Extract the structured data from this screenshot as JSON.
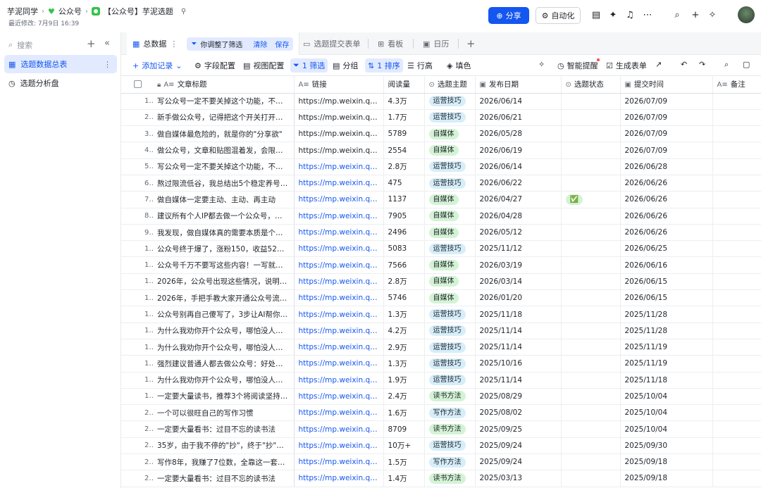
{
  "breadcrumb": {
    "root": "芋泥同学",
    "folder": "公众号",
    "doc": "【公众号】芋泥选题"
  },
  "modified": "最近修改: 7月9日 16:39",
  "header": {
    "share": "分享",
    "automation": "自动化"
  },
  "sidebar": {
    "search_placeholder": "搜索",
    "items": [
      {
        "label": "选题数据总表",
        "active": true
      },
      {
        "label": "选题分析盘",
        "active": false
      }
    ]
  },
  "tabs": {
    "main": "总数据",
    "filter_chip": "你调整了筛选",
    "clear": "清除",
    "save": "保存",
    "form": "选题提交表单",
    "kanban": "看板",
    "calendar": "日历"
  },
  "toolbar": {
    "add": "添加记录",
    "fields": "字段配置",
    "view": "视图配置",
    "filter": "1 筛选",
    "group": "分组",
    "sort": "1 排序",
    "rowheight": "行高",
    "fill": "填色",
    "remind": "智能提醒",
    "form": "生成表单"
  },
  "columns": [
    "文章标题",
    "链接",
    "阅读量",
    "选题主题",
    "发布日期",
    "选题状态",
    "提交时间",
    "备注"
  ],
  "rows": [
    {
      "n": "1",
      "title": "写公众号一定不要关掉这个功能，不然...",
      "link": "https://mp.weixin.qq.co...",
      "blue": false,
      "reads": "4.3万",
      "topic": "运营技巧",
      "pub": "2026/06/14",
      "status": "",
      "submit": "2026/07/09"
    },
    {
      "n": "2",
      "title": "新手做公众号，记得把这个开关打开，...",
      "link": "https://mp.weixin.qq.co...",
      "blue": false,
      "reads": "1.7万",
      "topic": "运营技巧",
      "pub": "2026/06/21",
      "status": "",
      "submit": "2026/07/09"
    },
    {
      "n": "3",
      "title": "做自媒体最危险的，就是你的\"分享欲\"",
      "link": "https://mp.weixin.qq.co...",
      "blue": false,
      "reads": "5789",
      "topic": "自媒体",
      "pub": "2026/05/28",
      "status": "",
      "submit": "2026/07/09"
    },
    {
      "n": "4",
      "title": "做公众号，文章和贴图混着发，会限流...",
      "link": "https://mp.weixin.qq.co...",
      "blue": false,
      "reads": "2554",
      "topic": "自媒体",
      "pub": "2026/06/19",
      "status": "",
      "submit": "2026/07/09"
    },
    {
      "n": "5",
      "title": "写公众号一定不要关掉这个功能，不然...",
      "link": "https://mp.weixin.qq.co...",
      "blue": true,
      "reads": "2.8万",
      "topic": "运营技巧",
      "pub": "2026/06/14",
      "status": "",
      "submit": "2026/06/28"
    },
    {
      "n": "6",
      "title": "熬过限流低谷，我总结出5个稳定养号小...",
      "link": "https://mp.weixin.qq.co...",
      "blue": true,
      "reads": "475",
      "topic": "运营技巧",
      "pub": "2026/06/22",
      "status": "",
      "submit": "2026/06/26"
    },
    {
      "n": "7",
      "title": "做自媒体一定要主动、主动、再主动",
      "link": "https://mp.weixin.qq.co...",
      "blue": true,
      "reads": "1137",
      "topic": "自媒体",
      "pub": "2026/04/27",
      "status": "✅",
      "submit": "2026/06/26"
    },
    {
      "n": "8",
      "title": "建议所有个人IP都去做一个公众号，因为...",
      "link": "https://mp.weixin.qq.co...",
      "blue": true,
      "reads": "7905",
      "topic": "自媒体",
      "pub": "2026/04/28",
      "status": "",
      "submit": "2026/06/26"
    },
    {
      "n": "9",
      "title": "我发现，做自媒体真的需要本质是个厉...",
      "link": "https://mp.weixin.qq.co...",
      "blue": true,
      "reads": "2496",
      "topic": "自媒体",
      "pub": "2026/05/12",
      "status": "",
      "submit": "2026/06/26"
    },
    {
      "n": "10",
      "title": "公众号终于爆了，涨粉150，收益52，送...",
      "link": "https://mp.weixin.qq.co...",
      "blue": true,
      "reads": "5083",
      "topic": "运营技巧",
      "pub": "2025/11/12",
      "status": "",
      "submit": "2026/06/25"
    },
    {
      "n": "11",
      "title": "公众号千万不要写这些内容！一写就限流",
      "link": "https://mp.weixin.qq.co...",
      "blue": true,
      "reads": "7566",
      "topic": "自媒体",
      "pub": "2026/03/19",
      "status": "",
      "submit": "2026/06/16"
    },
    {
      "n": "12",
      "title": "2026年，公众号出现这些情况，说明你...",
      "link": "https://mp.weixin.qq.co...",
      "blue": true,
      "reads": "2.8万",
      "topic": "自媒体",
      "pub": "2026/03/14",
      "status": "",
      "submit": "2026/06/15"
    },
    {
      "n": "13",
      "title": "2026年，手把手教大家开通公众号流量...",
      "link": "https://mp.weixin.qq.co...",
      "blue": true,
      "reads": "5746",
      "topic": "自媒体",
      "pub": "2026/01/20",
      "status": "",
      "submit": "2026/06/15"
    },
    {
      "n": "14",
      "title": "公众号别再自己傻写了，3步让AI帮你复...",
      "link": "https://mp.weixin.qq.co...",
      "blue": true,
      "reads": "1.3万",
      "topic": "运营技巧",
      "pub": "2025/11/18",
      "status": "",
      "submit": "2025/11/28"
    },
    {
      "n": "15",
      "title": "为什么我劝你开个公众号，哪怕没人看...",
      "link": "https://mp.weixin.qq.co...",
      "blue": true,
      "reads": "4.2万",
      "topic": "运营技巧",
      "pub": "2025/11/14",
      "status": "",
      "submit": "2025/11/28"
    },
    {
      "n": "16",
      "title": "为什么我劝你开个公众号，哪怕没人看...",
      "link": "https://mp.weixin.qq.co...",
      "blue": true,
      "reads": "2.9万",
      "topic": "运营技巧",
      "pub": "2025/11/14",
      "status": "",
      "submit": "2025/11/19"
    },
    {
      "n": "17",
      "title": "强烈建议普通人都去做公众号：好处太多",
      "link": "https://mp.weixin.qq.co...",
      "blue": true,
      "reads": "1.3万",
      "topic": "运营技巧",
      "pub": "2025/10/16",
      "status": "",
      "submit": "2025/11/19"
    },
    {
      "n": "18",
      "title": "为什么我劝你开个公众号，哪怕没人看...",
      "link": "https://mp.weixin.qq.co...",
      "blue": true,
      "reads": "1.9万",
      "topic": "运营技巧",
      "pub": "2025/11/14",
      "status": "",
      "submit": "2025/11/18"
    },
    {
      "n": "19",
      "title": "一定要大量读书，推荐3个将阅读坚持下...",
      "link": "https://mp.weixin.qq.co...",
      "blue": true,
      "reads": "2.4万",
      "topic": "读书方法",
      "pub": "2025/08/29",
      "status": "",
      "submit": "2025/10/04"
    },
    {
      "n": "20",
      "title": "一个可以很旺自己的写作习惯",
      "link": "https://mp.weixin.qq.co...",
      "blue": true,
      "reads": "1.6万",
      "topic": "写作方法",
      "pub": "2025/08/02",
      "status": "",
      "submit": "2025/10/04"
    },
    {
      "n": "21",
      "title": "一定要大量看书：过目不忘的读书法",
      "link": "https://mp.weixin.qq.co...",
      "blue": true,
      "reads": "8709",
      "topic": "读书方法",
      "pub": "2025/09/25",
      "status": "",
      "submit": "2025/10/04"
    },
    {
      "n": "22",
      "title": "35岁，由于我不停的\"抄\"，终于\"抄\"出1...",
      "link": "https://mp.weixin.qq.co...",
      "blue": true,
      "reads": "10万+",
      "topic": "运营技巧",
      "pub": "2025/09/24",
      "status": "",
      "submit": "2025/09/30"
    },
    {
      "n": "23",
      "title": "写作8年，我赚了7位数，全靠这一套自...",
      "link": "https://mp.weixin.qq.co...",
      "blue": true,
      "reads": "1.5万",
      "topic": "写作方法",
      "pub": "2025/09/24",
      "status": "",
      "submit": "2025/09/18"
    },
    {
      "n": "24",
      "title": "一定要大量看书：过目不忘的读书法",
      "link": "https://mp.weixin.qq.co...",
      "blue": true,
      "reads": "1.4万",
      "topic": "读书方法",
      "pub": "2025/03/13",
      "status": "",
      "submit": "2025/09/18"
    }
  ]
}
